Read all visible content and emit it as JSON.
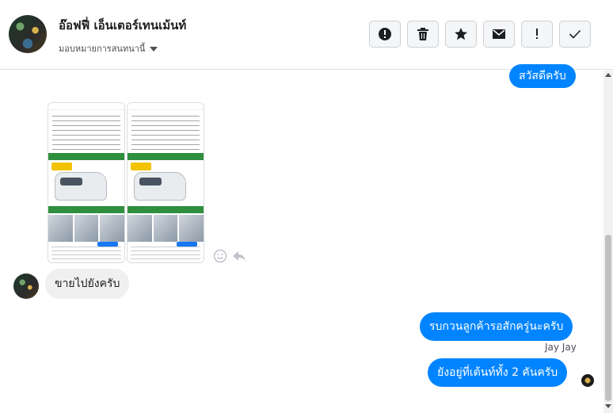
{
  "header": {
    "title": "อ๊อฟฟี่ เอ็นเตอร์เทนเม้นท์",
    "assign_label": "มอบหมายการสนทนานี้"
  },
  "toolbar": {
    "icons": [
      "alert-circle-icon",
      "trash-icon",
      "star-icon",
      "envelope-icon",
      "exclamation-icon",
      "checkmark-icon"
    ]
  },
  "messages": {
    "greeting": "สวัสดีครับ",
    "incoming": "ขายไปยังครับ",
    "reply1": "รบกวนลูกค้ารอสักครู่นะครับ",
    "sender_name": "Jay Jay",
    "reply2": "ยังอยู่ที่เต้นท์ทั้ง 2 คันครับ"
  },
  "colors": {
    "outgoing_bubble": "#0084ff",
    "incoming_bubble": "#f1f0f0"
  }
}
